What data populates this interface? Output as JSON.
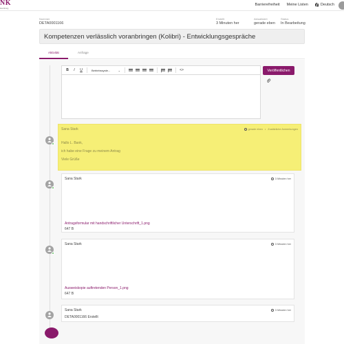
{
  "header": {
    "logo_text": "NK",
    "logo_subtext": "Hamburg",
    "nav": [
      "Barrierefreiheit",
      "Meine Listen",
      "Deutsch"
    ]
  },
  "meta": {
    "nummer_label": "Nummer",
    "nummer_value": "DETA0001166",
    "erstellt_label": "Erstellt",
    "erstellt_value": "3 Minuten her",
    "aktualisiert_label": "Aktualisiert",
    "aktualisiert_value": "gerade eben",
    "status_label": "Status",
    "status_value": "In Bearbeitung"
  },
  "title": "Kompetenzen verlässlich voranbringen (Kolibri) - Entwicklungsgespräche",
  "tabs": [
    {
      "label": "Aktivität",
      "active": true
    },
    {
      "label": "Anfrage",
      "active": false
    }
  ],
  "editor": {
    "format_select": "Betriebssyste...",
    "publish_label": "Veröffentlichen"
  },
  "activities": [
    {
      "author": "Sana Stark",
      "time": "gerade eben",
      "extra": "Zusätzliche Anmerkungen",
      "lines": [
        "Hallo L. Bank,",
        "ich habe eine Frage zu meinem Antrag",
        "Viele Grüße"
      ]
    },
    {
      "author": "Sana Stark",
      "time": "3 Minuten her",
      "file": "Antragsformular mit handschriftlicher Unterschrift_1.png",
      "size": "647 B"
    },
    {
      "author": "Sana Stark",
      "time": "3 Minuten her",
      "file": "Ausweiskopie auftretenden Person_1.png",
      "size": "647 B"
    },
    {
      "author": "Sana Stark",
      "time": "3 Minuten her",
      "text": "DETA0001166 Erstellt"
    }
  ],
  "colors": {
    "brand": "#8a1a6b",
    "highlight": "#f6ef76",
    "online": "#5cb85c"
  }
}
